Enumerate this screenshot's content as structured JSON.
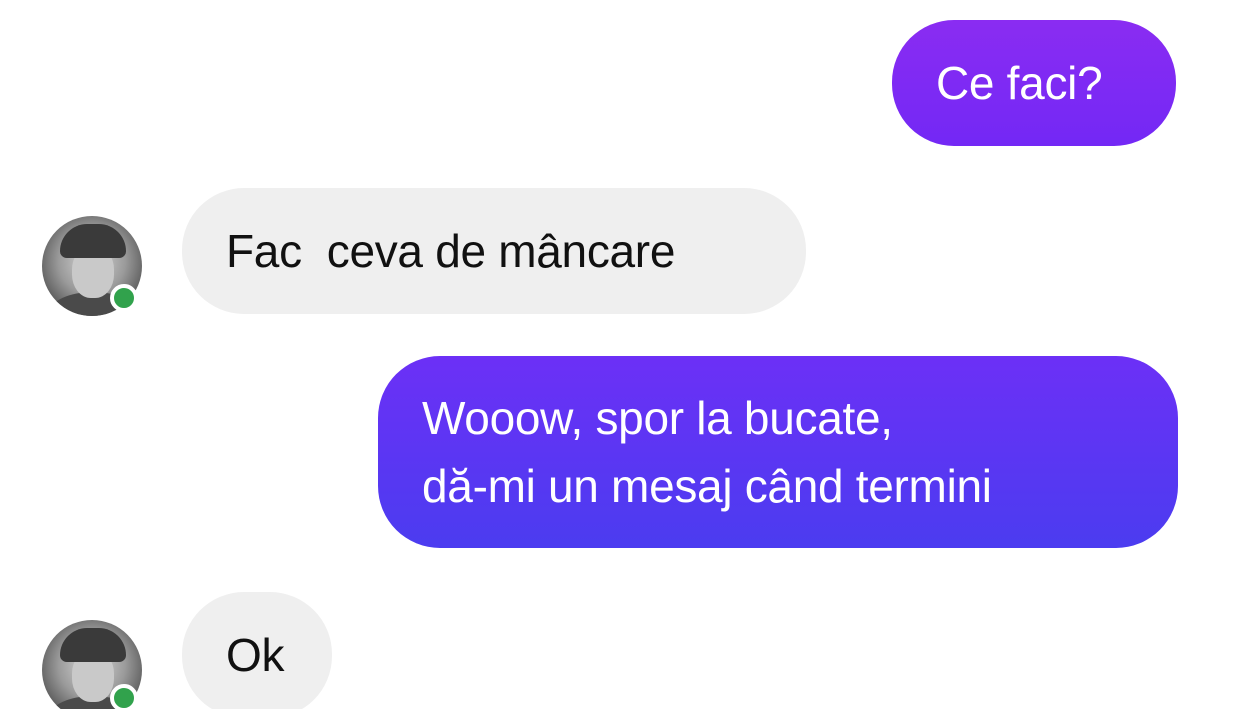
{
  "messages": [
    {
      "direction": "outgoing",
      "lines": [
        "Ce faci?"
      ]
    },
    {
      "direction": "incoming",
      "lines": [
        "Fac  ceva de mâncare"
      ]
    },
    {
      "direction": "outgoing",
      "lines": [
        "Wooow, spor la bucate,",
        "dă-mi un mesaj când termini"
      ]
    },
    {
      "direction": "incoming",
      "lines": [
        "Ok"
      ]
    }
  ],
  "colors": {
    "outgoing_top": "#8a2cf2",
    "outgoing_bottom": "#4b3cf0",
    "incoming_bubble": "#efefef",
    "online_indicator": "#31a24c"
  },
  "contact": {
    "status": "online"
  }
}
